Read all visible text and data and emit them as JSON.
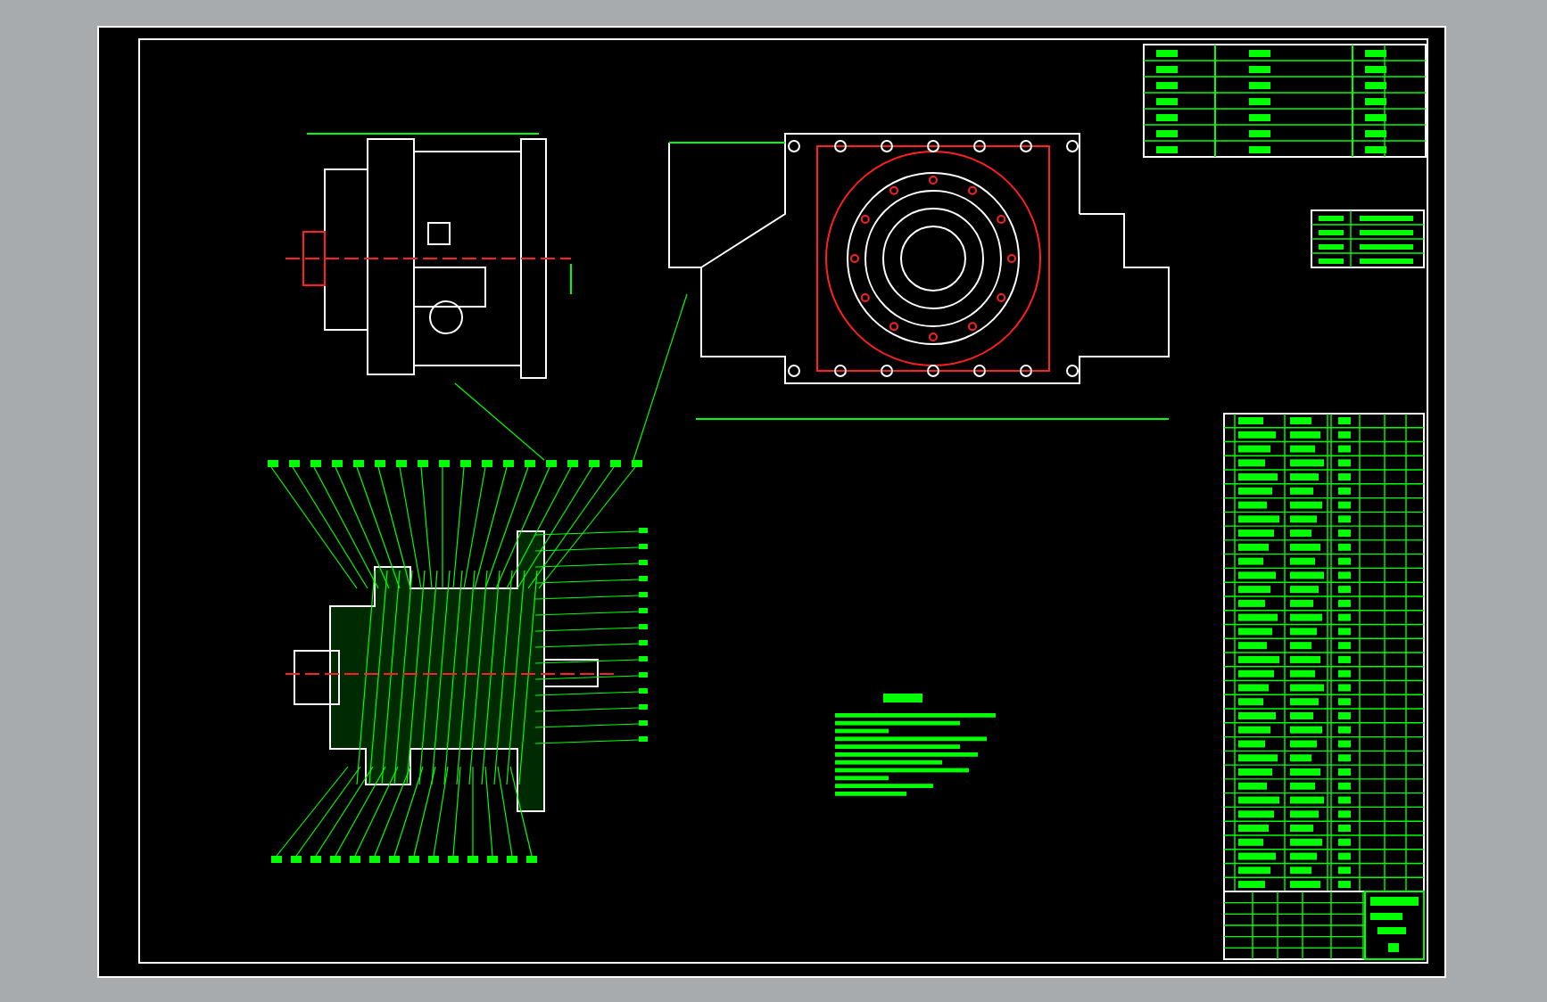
{
  "drawing": {
    "views": [
      {
        "kind": "side-view"
      },
      {
        "kind": "top-view"
      },
      {
        "kind": "section-view"
      }
    ],
    "tables": [
      {
        "kind": "parameter-table"
      },
      {
        "kind": "info-table"
      },
      {
        "kind": "parts-list"
      },
      {
        "kind": "title-block"
      }
    ],
    "notes": [
      {
        "kind": "technical-requirements"
      }
    ]
  }
}
